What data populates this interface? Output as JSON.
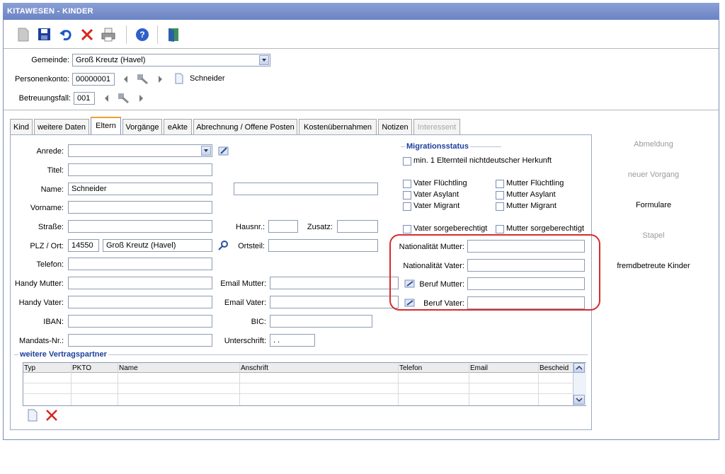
{
  "window": {
    "title": "KITAWESEN - KINDER"
  },
  "toolbar": {
    "icons": [
      "new-doc-icon",
      "save-icon",
      "undo-icon",
      "delete-icon",
      "print-icon",
      "help-icon",
      "exit-icon"
    ],
    "colors": {
      "save": "#1d3c9c",
      "undo": "#1d57c4",
      "delete": "#d8261c",
      "help": "#2f5fc9"
    }
  },
  "header": {
    "gemeinde_label": "Gemeinde:",
    "gemeinde_value": "Groß Kreutz (Havel)",
    "personenkonto_label": "Personenkonto:",
    "personenkonto_value": "00000001",
    "personenkonto_name": "Schneider",
    "betreuungsfall_label": "Betreuungsfall:",
    "betreuungsfall_value": "001"
  },
  "tabs": [
    {
      "label": "Kind"
    },
    {
      "label": "weitere Daten"
    },
    {
      "label": "Eltern"
    },
    {
      "label": "Vorgänge"
    },
    {
      "label": "eAkte"
    },
    {
      "label": "Abrechnung / Offene Posten"
    },
    {
      "label": "Kostenübernahmen"
    },
    {
      "label": "Notizen"
    },
    {
      "label": "Interessent"
    }
  ],
  "form": {
    "anrede_label": "Anrede:",
    "titel_label": "Titel:",
    "name_label": "Name:",
    "name_value": "Schneider",
    "vorname_label": "Vorname:",
    "strasse_label": "Straße:",
    "hausnr_label": "Hausnr.:",
    "zusatz_label": "Zusatz:",
    "plz_label": "PLZ / Ort:",
    "plz_value": "14550",
    "ort_value": "Groß Kreutz (Havel)",
    "ortsteil_label": "Ortsteil:",
    "telefon_label": "Telefon:",
    "handy_mutter_label": "Handy Mutter:",
    "email_mutter_label": "Email Mutter:",
    "handy_vater_label": "Handy Vater:",
    "email_vater_label": "Email Vater:",
    "iban_label": "IBAN:",
    "bic_label": "BIC:",
    "mandats_label": "Mandats-Nr.:",
    "unterschrift_label": "Unterschrift:",
    "unterschrift_value": ". ."
  },
  "migration": {
    "title": "Migrationsstatus",
    "min_elternteil": "min. 1 Elternteil nichtdeutscher Herkunft",
    "vater_fluechtling": "Vater Flüchtling",
    "mutter_fluechtling": "Mutter Flüchtling",
    "vater_asylant": "Vater Asylant",
    "mutter_asylant": "Mutter Asylant",
    "vater_migrant": "Vater Migrant",
    "mutter_migrant": "Mutter Migrant",
    "vater_sorge": "Vater sorgeberechtigt",
    "mutter_sorge": "Mutter sorgeberechtigt",
    "nat_mutter_label": "Nationalität Mutter:",
    "nat_vater_label": "Nationalität Vater:",
    "beruf_mutter_label": "Beruf Mutter:",
    "beruf_vater_label": "Beruf Vater:",
    "highlight_color": "#d62c2c"
  },
  "vertragspartner": {
    "title": "weitere Vertragspartner",
    "columns": [
      "Typ",
      "PKTO",
      "Name",
      "Anschrift",
      "Telefon",
      "Email",
      "Bescheid"
    ]
  },
  "sidebar": {
    "abmeldung": "Abmeldung",
    "neuer_vorgang": "neuer Vorgang",
    "formulare": "Formulare",
    "stapel": "Stapel",
    "fremdbetreute": "fremdbetreute Kinder"
  }
}
